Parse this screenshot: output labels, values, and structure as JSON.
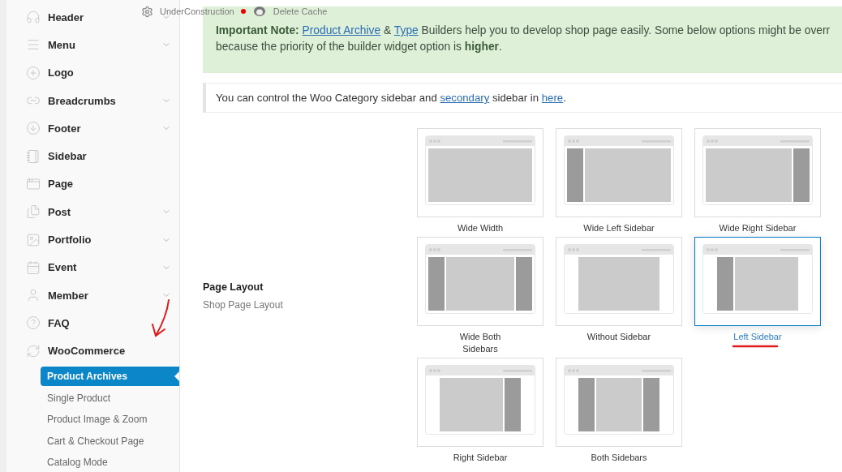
{
  "admin_bar": {
    "items": [
      {
        "kind": "status",
        "label": "UnderConstruction"
      },
      {
        "kind": "action",
        "label": "Delete Cache"
      }
    ]
  },
  "sidebar": {
    "items": [
      {
        "label": "Header",
        "has_children": true
      },
      {
        "label": "Menu",
        "has_children": true
      },
      {
        "label": "Logo",
        "has_children": false
      },
      {
        "label": "Breadcrumbs",
        "has_children": true
      },
      {
        "label": "Footer",
        "has_children": true
      },
      {
        "label": "Sidebar",
        "has_children": false
      },
      {
        "label": "Page",
        "has_children": false
      },
      {
        "label": "Post",
        "has_children": true
      },
      {
        "label": "Portfolio",
        "has_children": true
      },
      {
        "label": "Event",
        "has_children": true
      },
      {
        "label": "Member",
        "has_children": true
      },
      {
        "label": "FAQ",
        "has_children": false
      },
      {
        "label": "WooCommerce",
        "has_children": false,
        "children": [
          {
            "label": "Product Archives",
            "selected": true
          },
          {
            "label": "Single Product",
            "selected": false
          },
          {
            "label": "Product Image & Zoom",
            "selected": false
          },
          {
            "label": "Cart & Checkout Page",
            "selected": false
          },
          {
            "label": "Catalog Mode",
            "selected": false
          }
        ]
      }
    ]
  },
  "notice": {
    "lines": [
      [
        {
          "text": "**Important Note:** ",
          "link": false
        },
        {
          "text": "Product Archive",
          "link": true
        },
        {
          "text": " & ",
          "link": false
        },
        {
          "text": "Type",
          "link": true
        },
        {
          "text": " Builders help you to develop shop page easily. Some below options might be overr",
          "link": false
        }
      ],
      [
        {
          "text": "because the priority of the builder widget option is **higher**.",
          "link": false
        }
      ]
    ]
  },
  "info": {
    "segments": [
      {
        "text": "You can control the Woo Category sidebar and ",
        "link": false
      },
      {
        "text": "secondary",
        "link": true
      },
      {
        "text": " sidebar in ",
        "link": false
      },
      {
        "text": "here",
        "link": true
      },
      {
        "text": ".",
        "link": false
      }
    ]
  },
  "setting": {
    "title": "Page Layout",
    "subtitle": "Shop Page Layout",
    "options": [
      {
        "label": "Wide Width",
        "wide": true,
        "kind": "none",
        "selected": false
      },
      {
        "label": "Wide Left Sidebar",
        "wide": true,
        "kind": "left",
        "selected": false
      },
      {
        "label": "Wide Right Sidebar",
        "wide": true,
        "kind": "right",
        "selected": false
      },
      {
        "label": "Wide Both\nSidebars",
        "wide": true,
        "kind": "both",
        "selected": false
      },
      {
        "label": "Without Sidebar",
        "wide": false,
        "kind": "none",
        "selected": false
      },
      {
        "label": "Left Sidebar",
        "wide": false,
        "kind": "left",
        "selected": true
      },
      {
        "label": "Right Sidebar",
        "wide": false,
        "kind": "right",
        "selected": false
      },
      {
        "label": "Both Sidebars",
        "wide": false,
        "kind": "both",
        "selected": false
      }
    ]
  }
}
